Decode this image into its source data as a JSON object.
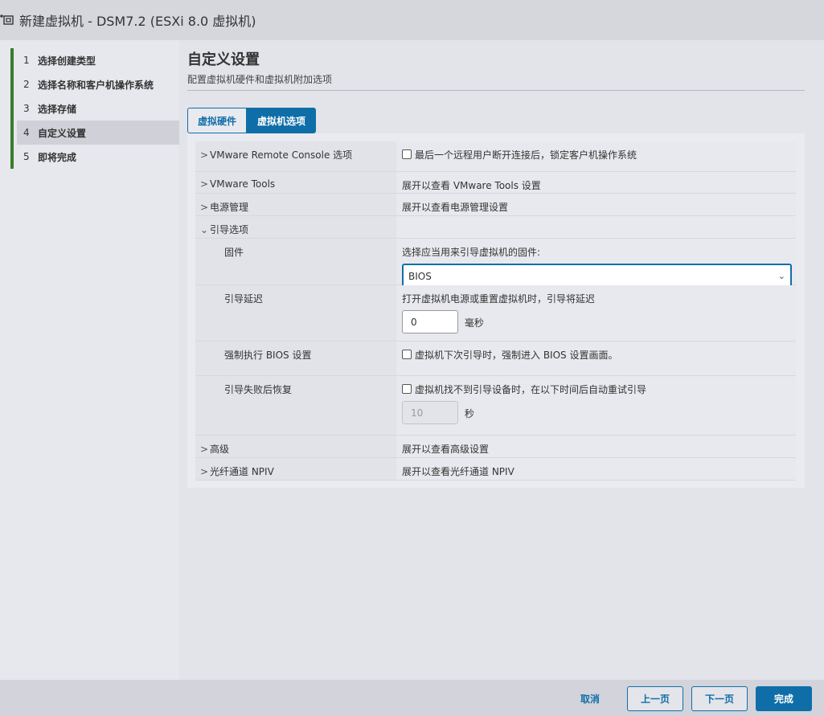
{
  "window": {
    "title": "新建虚拟机 - DSM7.2 (ESXi 8.0 虚拟机)"
  },
  "steps": [
    {
      "num": "1",
      "label": "选择创建类型"
    },
    {
      "num": "2",
      "label": "选择名称和客户机操作系统"
    },
    {
      "num": "3",
      "label": "选择存储"
    },
    {
      "num": "4",
      "label": "自定义设置"
    },
    {
      "num": "5",
      "label": "即将完成"
    }
  ],
  "page": {
    "title": "自定义设置",
    "subtitle": "配置虚拟机硬件和虚拟机附加选项"
  },
  "tabs": {
    "hardware": "虚拟硬件",
    "options": "虚拟机选项"
  },
  "rows": {
    "vmrc": {
      "label": "VMware Remote Console 选项",
      "value": "最后一个远程用户断开连接后，锁定客户机操作系统"
    },
    "tools": {
      "label": "VMware Tools",
      "value": "展开以查看 VMware Tools 设置"
    },
    "power": {
      "label": "电源管理",
      "value": "展开以查看电源管理设置"
    },
    "boot": {
      "label": "引导选项"
    },
    "firmware": {
      "label": "固件",
      "hint": "选择应当用来引导虚拟机的固件:",
      "selected": "BIOS"
    },
    "boot_delay": {
      "label": "引导延迟",
      "hint": "打开虚拟机电源或重置虚拟机时，引导将延迟",
      "value": "0",
      "unit": "毫秒"
    },
    "force_bios": {
      "label": "强制执行 BIOS 设置",
      "value": "虚拟机下次引导时，强制进入 BIOS 设置画面。"
    },
    "retry": {
      "label": "引导失败后恢复",
      "value": "虚拟机找不到引导设备时，在以下时间后自动重试引导",
      "seconds": "10",
      "unit": "秒"
    },
    "advanced": {
      "label": "高级",
      "value": "展开以查看高级设置"
    },
    "npiv": {
      "label": "光纤通道 NPIV",
      "value": "展开以查看光纤通道 NPIV"
    }
  },
  "footer": {
    "cancel": "取消",
    "back": "上一页",
    "next": "下一页",
    "finish": "完成"
  }
}
